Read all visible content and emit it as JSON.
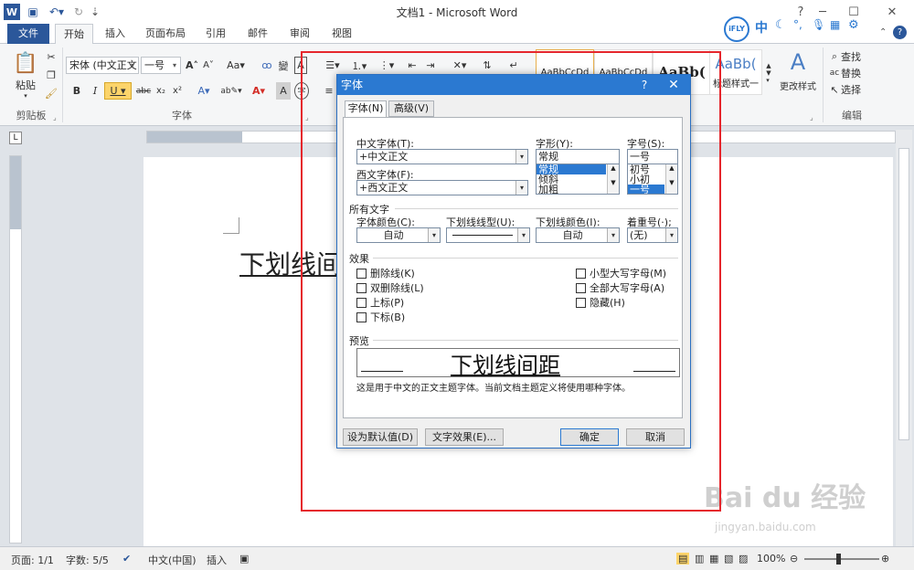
{
  "window": {
    "title": "文档1 - Microsoft Word"
  },
  "tabs": [
    "文件",
    "开始",
    "插入",
    "页面布局",
    "引用",
    "邮件",
    "审阅",
    "视图"
  ],
  "ifly": {
    "logo": "iFLY",
    "mode": "中"
  },
  "ribbon": {
    "paste_label": "粘贴",
    "font_name": "宋体 (中文正文",
    "font_size": "一号",
    "bold": "B",
    "italic": "I",
    "underline": "U",
    "styles": [
      {
        "preview": "AaBbCcDd"
      },
      {
        "preview": "AaBbCcDd"
      },
      {
        "preview": "AaBb("
      },
      {
        "preview": "AaBb(",
        "label": "标题样式一"
      }
    ],
    "change_styles": "更改样式",
    "find": "查找",
    "replace": "替换",
    "select": "选择",
    "groups": {
      "clipboard": "剪贴板",
      "font": "字体",
      "editing": "编辑"
    }
  },
  "document": {
    "text": "下划线间"
  },
  "dialog": {
    "title": "字体",
    "help": "?",
    "close": "✕",
    "tabs": [
      "字体(N)",
      "高级(V)"
    ],
    "chinese_font_label": "中文字体(T):",
    "chinese_font_value": "+中文正文",
    "western_font_label": "西文字体(F):",
    "western_font_value": "+西文正文",
    "style_label": "字形(Y):",
    "style_value": "常规",
    "style_options": [
      "常规",
      "倾斜",
      "加粗"
    ],
    "size_label": "字号(S):",
    "size_value": "一号",
    "size_options": [
      "初号",
      "小初",
      "一号"
    ],
    "all_text_section": "所有文字",
    "font_color_label": "字体颜色(C):",
    "font_color_value": "自动",
    "underline_style_label": "下划线线型(U):",
    "underline_color_label": "下划线颜色(I):",
    "underline_color_value": "自动",
    "emphasis_label": "着重号(·);",
    "emphasis_value": "(无)",
    "effects_section": "效果",
    "effects_left": [
      "删除线(K)",
      "双删除线(L)",
      "上标(P)",
      "下标(B)"
    ],
    "effects_right": [
      "小型大写字母(M)",
      "全部大写字母(A)",
      "隐藏(H)"
    ],
    "preview_section": "预览",
    "preview_text": "下划线间距",
    "preview_note": "这是用于中文的正文主题字体。当前文档主题定义将使用哪种字体。",
    "btn_default": "设为默认值(D)",
    "btn_effects": "文字效果(E)...",
    "btn_ok": "确定",
    "btn_cancel": "取消"
  },
  "statusbar": {
    "page": "页面: 1/1",
    "words": "字数: 5/5",
    "language": "中文(中国)",
    "insert": "插入",
    "zoom": "100%"
  },
  "watermark": {
    "brand": "Bai du 经验",
    "url": "jingyan.baidu.com"
  },
  "colors": {
    "word_blue": "#2b579a",
    "dialog_title": "#2b79d1",
    "highlight": "#e5262c"
  }
}
